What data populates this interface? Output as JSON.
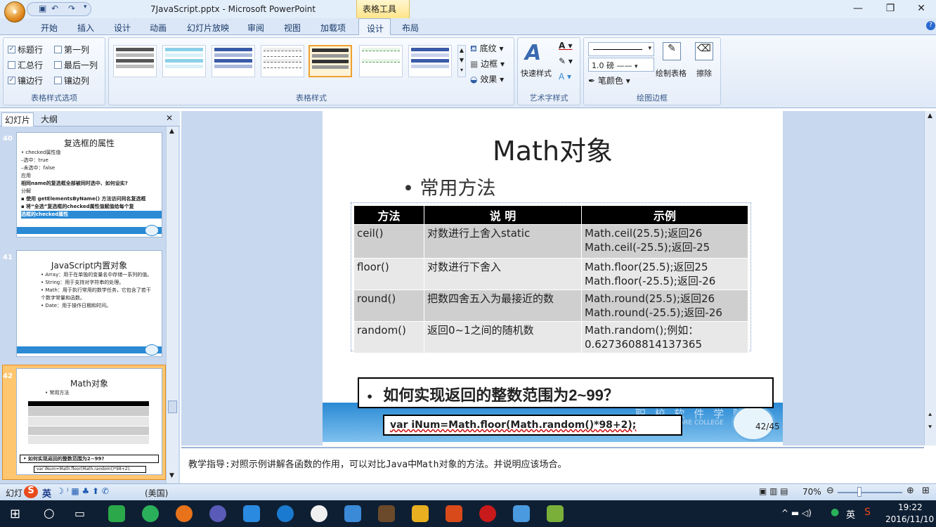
{
  "window": {
    "title": "7JavaScript.pptx - Microsoft PowerPoint",
    "tools_label": "表格工具",
    "minimize": "—",
    "maximize": "❐",
    "close": "✕"
  },
  "tabs": [
    "开始",
    "插入",
    "设计",
    "动画",
    "幻灯片放映",
    "审阅",
    "视图",
    "加载项",
    "设计",
    "布局"
  ],
  "ribbon": {
    "options": {
      "header_row": "标题行",
      "first_col": "第一列",
      "total_row": "汇总行",
      "last_col": "最后一列",
      "banded_rows": "镶边行",
      "banded_cols": "镶边列",
      "group_label": "表格样式选项"
    },
    "styles_label": "表格样式",
    "shading": "底纹",
    "borders": "边框",
    "effects": "效果",
    "quick_styles": "快速样式",
    "wordart_label": "艺术字样式",
    "pen_weight": "1.0 磅",
    "pen_color": "笔颜色",
    "draw_table": "绘制表格",
    "eraser": "擦除",
    "draw_borders_label": "绘图边框"
  },
  "left_panel": {
    "tab_slides": "幻灯片",
    "tab_outline": "大纲",
    "close": "✕",
    "thumbs": [
      {
        "num": "40",
        "title": "复选框的属性",
        "lines": [
          "• checked属性值",
          "–选中：true",
          "–未选中：false",
          "应用",
          "相同name的复选框全部被同时选中、如何设实?",
          "分解",
          "▪ 使用 getElementsByName() 方法访问同名复选框",
          "▪ 将“全选”复选框的checked属性值赋值给每个复",
          "选框的checked属性"
        ]
      },
      {
        "num": "41",
        "title": "JavaScript内置对象",
        "lines": [
          "• Array：用于在单独的变量名中存储一系列的值。",
          "• String：用于支持对字符串的处理。",
          "• Math：用于执行常用的数学任务，它包含了若干个数字常量和函数。",
          "• Date：用于操作日期和时间。"
        ]
      },
      {
        "num": "42",
        "title": "Math对象",
        "lines": [
          "• 常用方法"
        ],
        "question": "• 如何实现返回的整数范围为2~99?",
        "code": "var iNum=Math.floor(Math.random()*98+2);"
      }
    ]
  },
  "slide": {
    "title": "Math对象",
    "bullet": "• 常用方法",
    "table": {
      "headers": [
        "方法",
        "说 明",
        "示例"
      ],
      "rows": [
        [
          "ceil()",
          "对数进行上舍入static",
          "Math.ceil(25.5);返回26",
          "Math.ceil(-25.5);返回-25"
        ],
        [
          "floor()",
          "对数进行下舍入",
          "Math.floor(25.5);返回25",
          "Math.floor(-25.5);返回-26"
        ],
        [
          "round()",
          "把数四舍五入为最接近的数",
          "Math.round(25.5);返回26",
          "Math.round(-25.5);返回-26"
        ],
        [
          "random()",
          "返回0~1之间的随机数",
          "Math.random();例如：",
          "0.6273608814137365"
        ]
      ]
    },
    "question_bullet": "•",
    "question_a": "如何实现返回的整数范围为",
    "question_b": "2~99",
    "question_c": "？",
    "code": "var iNum=Math.floor(Math.random()*98+2);",
    "college": "职 校 软 件 学 院",
    "college_en": "ARE COLLEGE",
    "page": "42/45"
  },
  "notes": "教学指导:对照示例讲解各函数的作用，可以对比Java中Math对象的方法。并说明应该场合。",
  "status": {
    "left": "幻灯",
    "ime": "英",
    "lang": "(美国)",
    "zoom": "70%"
  },
  "taskbar": {
    "time": "19:22",
    "date": "2016/11/10",
    "lang": "英"
  }
}
